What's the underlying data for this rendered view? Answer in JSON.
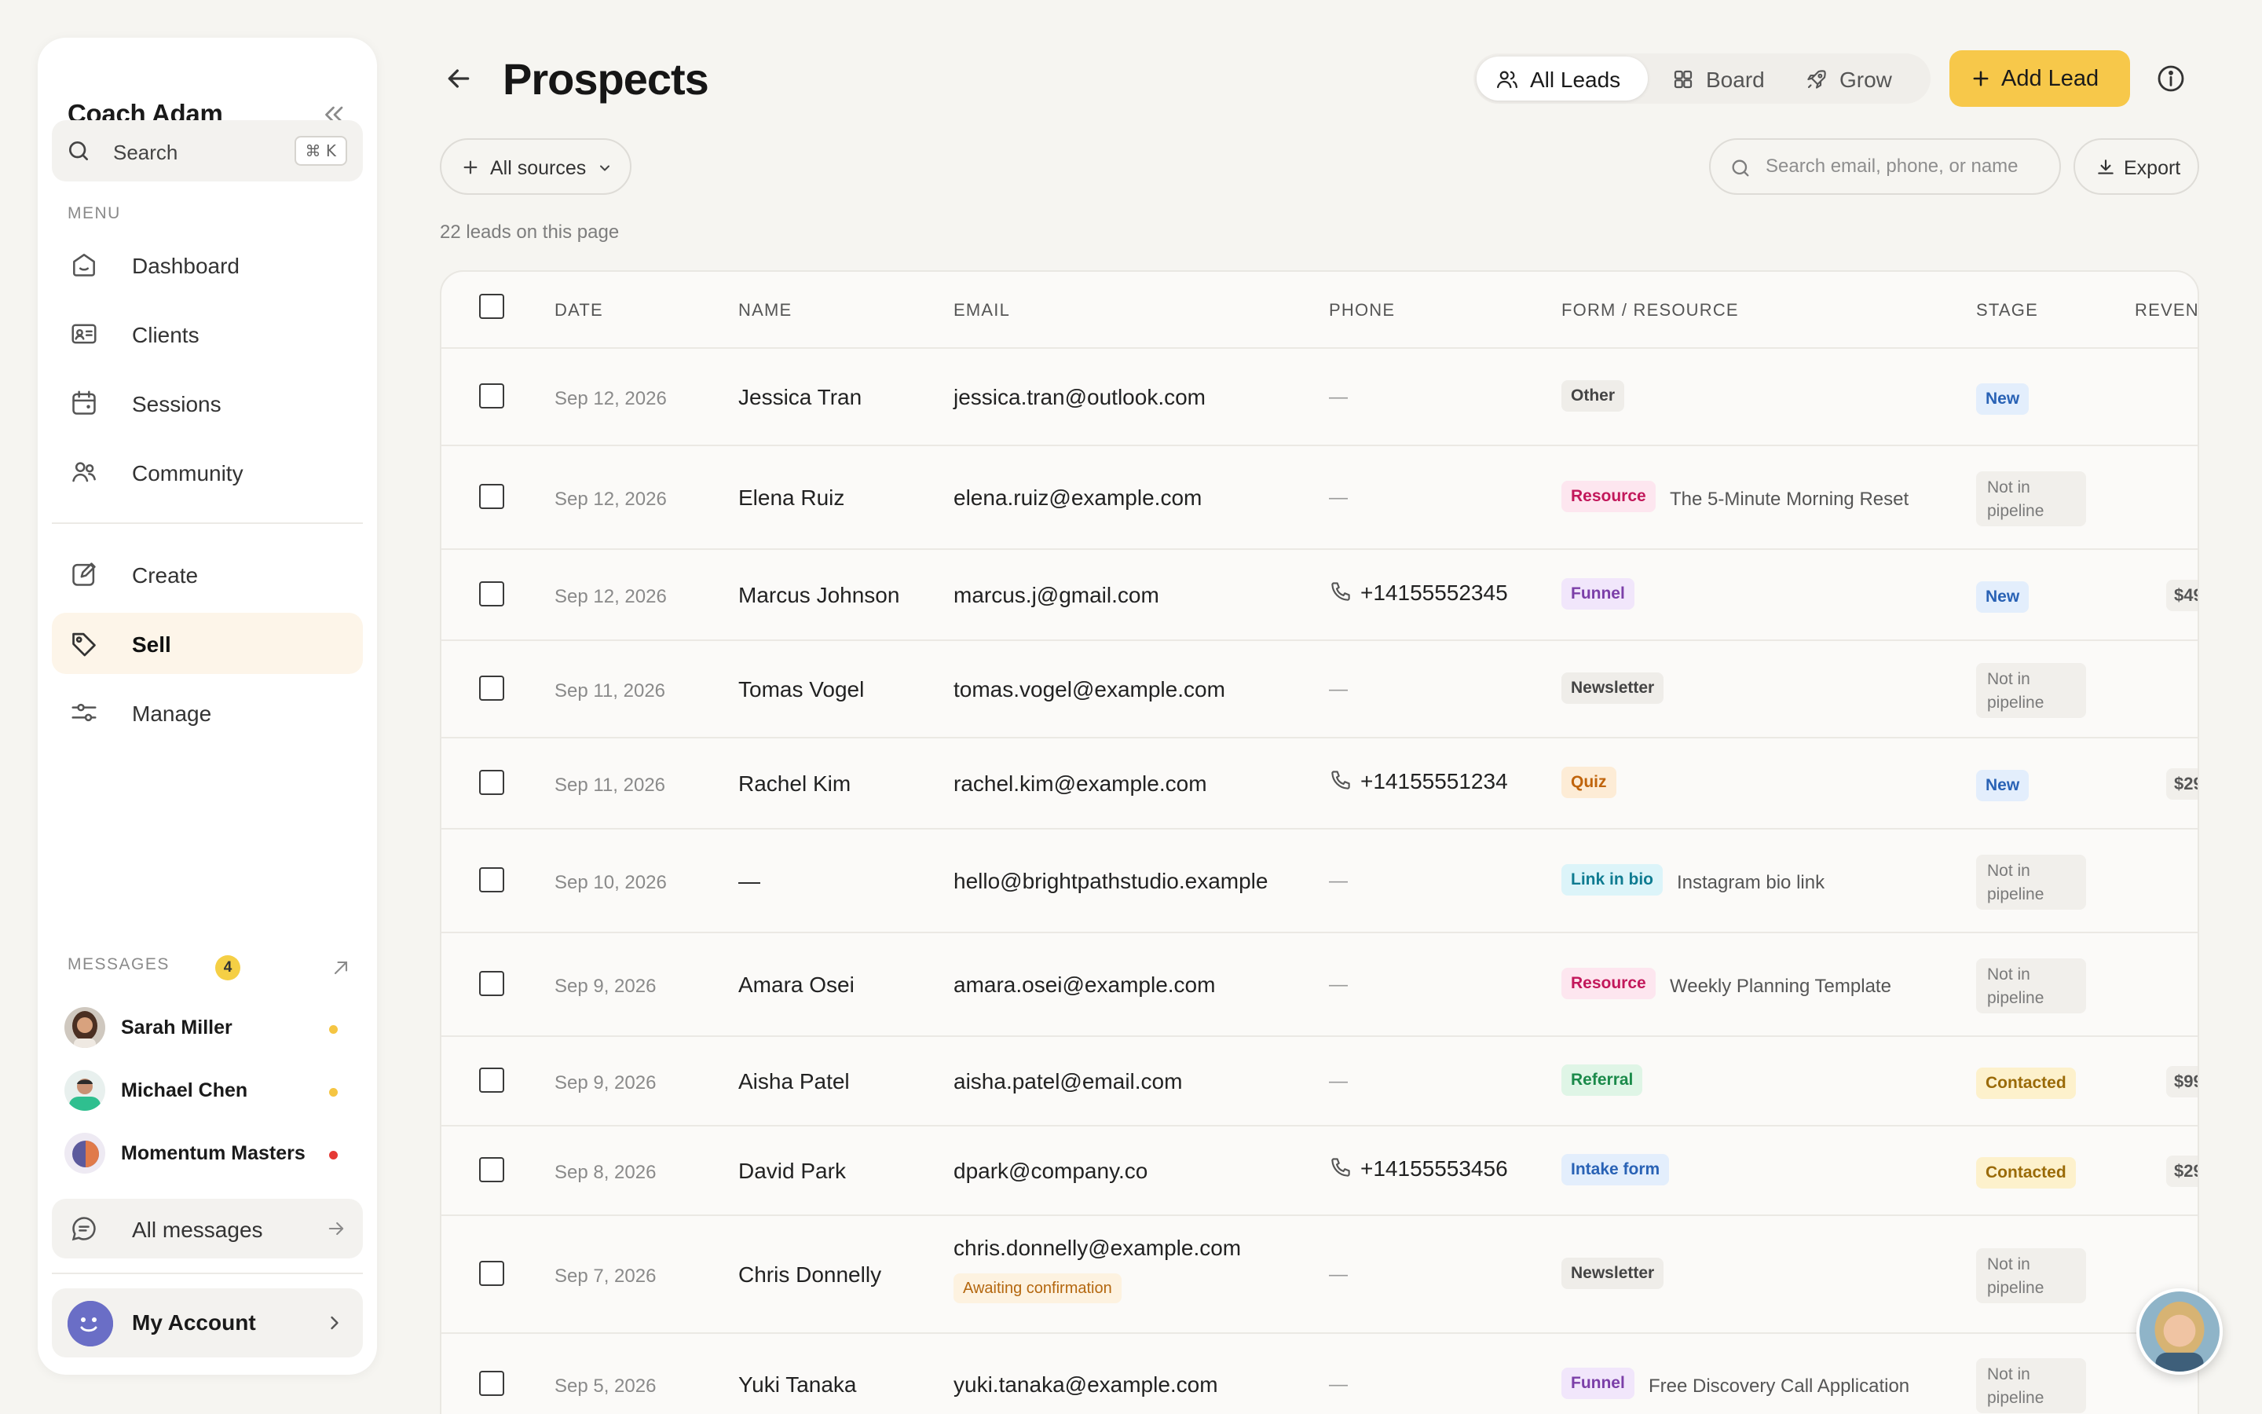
{
  "sidebar": {
    "brand": "Coach Adam",
    "search": {
      "label": "Search",
      "shortcut": "⌘ K"
    },
    "menu_label": "MENU",
    "items": [
      {
        "label": "Dashboard",
        "icon": "dashboard-icon"
      },
      {
        "label": "Clients",
        "icon": "clients-icon"
      },
      {
        "label": "Sessions",
        "icon": "calendar-icon"
      },
      {
        "label": "Community",
        "icon": "community-icon"
      },
      {
        "label": "Create",
        "icon": "edit-icon"
      },
      {
        "label": "Sell",
        "icon": "tag-icon",
        "active": true
      },
      {
        "label": "Manage",
        "icon": "sliders-icon"
      }
    ],
    "messages": {
      "label": "MESSAGES",
      "badge": "4",
      "threads": [
        {
          "name": "Sarah Miller",
          "dot_color": "#f5c542"
        },
        {
          "name": "Michael Chen",
          "dot_color": "#f5c542"
        },
        {
          "name": "Momentum Masters",
          "dot_color": "#e53935"
        }
      ],
      "all_label": "All messages"
    },
    "account_label": "My Account"
  },
  "header": {
    "title": "Prospects",
    "views": [
      {
        "label": "All Leads",
        "icon": "users-icon",
        "active": true
      },
      {
        "label": "Board",
        "icon": "grid-icon"
      },
      {
        "label": "Grow",
        "icon": "rocket-icon"
      }
    ],
    "add_label": "Add Lead"
  },
  "filters": {
    "sources_label": "All sources",
    "search_placeholder": "Search email, phone, or name",
    "export_label": "Export",
    "count_note": "22 leads on this page"
  },
  "table": {
    "columns": [
      "DATE",
      "NAME",
      "EMAIL",
      "PHONE",
      "FORM / RESOURCE",
      "STAGE",
      "REVEN"
    ],
    "rows": [
      {
        "date": "Sep 12, 2026",
        "name": "Jessica Tran",
        "email": "jessica.tran@outlook.com",
        "phone": "—",
        "tag": "Other",
        "tag_color": "gray",
        "resource": "",
        "stage": "New",
        "stage_color": "blue",
        "revenue": ""
      },
      {
        "date": "Sep 12, 2026",
        "name": "Elena Ruiz",
        "email": "elena.ruiz@example.com",
        "phone": "—",
        "tag": "Resource",
        "tag_color": "pink",
        "resource": "The 5-Minute Morning Reset",
        "stage": "Not in pipeline",
        "stage_color": "gray",
        "revenue": ""
      },
      {
        "date": "Sep 12, 2026",
        "name": "Marcus Johnson",
        "email": "marcus.j@gmail.com",
        "phone": "+14155552345",
        "tag": "Funnel",
        "tag_color": "purple",
        "resource": "",
        "stage": "New",
        "stage_color": "blue",
        "revenue": "$49"
      },
      {
        "date": "Sep 11, 2026",
        "name": "Tomas Vogel",
        "email": "tomas.vogel@example.com",
        "phone": "—",
        "tag": "Newsletter",
        "tag_color": "gray",
        "resource": "",
        "stage": "Not in pipeline",
        "stage_color": "gray",
        "revenue": ""
      },
      {
        "date": "Sep 11, 2026",
        "name": "Rachel Kim",
        "email": "rachel.kim@example.com",
        "phone": "+14155551234",
        "tag": "Quiz",
        "tag_color": "orange",
        "resource": "",
        "stage": "New",
        "stage_color": "blue",
        "revenue": "$29"
      },
      {
        "date": "Sep 10, 2026",
        "name": "—",
        "email": "hello@brightpathstudio.example",
        "phone": "—",
        "tag": "Link in bio",
        "tag_color": "cyan",
        "resource": "Instagram bio link",
        "stage": "Not in pipeline",
        "stage_color": "gray",
        "revenue": ""
      },
      {
        "date": "Sep 9, 2026",
        "name": "Amara Osei",
        "email": "amara.osei@example.com",
        "phone": "—",
        "tag": "Resource",
        "tag_color": "pink",
        "resource": "Weekly Planning Template",
        "stage": "Not in pipeline",
        "stage_color": "gray",
        "revenue": ""
      },
      {
        "date": "Sep 9, 2026",
        "name": "Aisha Patel",
        "email": "aisha.patel@email.com",
        "phone": "—",
        "tag": "Referral",
        "tag_color": "green",
        "resource": "",
        "stage": "Contacted",
        "stage_color": "yellow",
        "revenue": "$99"
      },
      {
        "date": "Sep 8, 2026",
        "name": "David Park",
        "email": "dpark@company.co",
        "phone": "+14155553456",
        "tag": "Intake form",
        "tag_color": "blue",
        "resource": "",
        "stage": "Contacted",
        "stage_color": "yellow",
        "revenue": "$29"
      },
      {
        "date": "Sep 7, 2026",
        "name": "Chris Donnelly",
        "email": "chris.donnelly@example.com",
        "email_note": "Awaiting confirmation",
        "phone": "—",
        "tag": "Newsletter",
        "tag_color": "gray",
        "resource": "",
        "stage": "Not in pipeline",
        "stage_color": "gray",
        "revenue": ""
      },
      {
        "date": "Sep 5, 2026",
        "name": "Yuki Tanaka",
        "email": "yuki.tanaka@example.com",
        "phone": "—",
        "tag": "Funnel",
        "tag_color": "purple",
        "resource": "Free Discovery Call Application",
        "stage": "Not in pipeline",
        "stage_color": "gray",
        "revenue": ""
      }
    ]
  },
  "colors": {
    "accent": "#f7c84a",
    "active_nav_bg": "#fdf5e9",
    "background": "#f6f5f1"
  }
}
